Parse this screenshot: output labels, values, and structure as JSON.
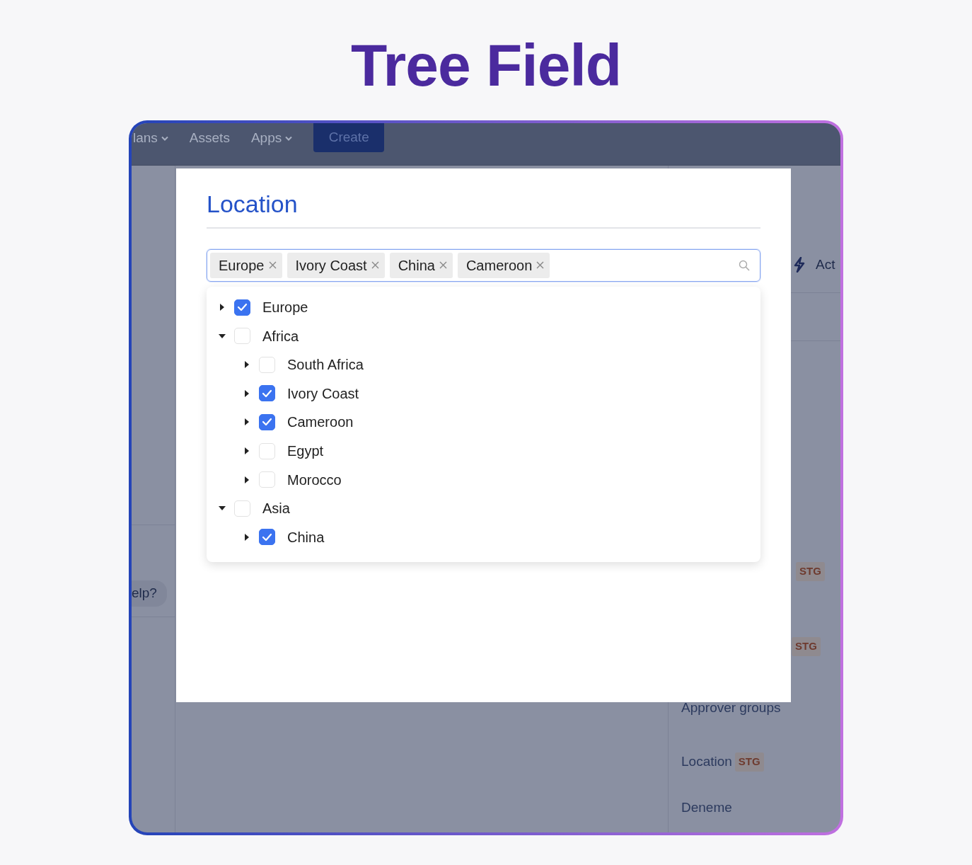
{
  "title": "Tree Field",
  "nav": {
    "items": [
      {
        "label": "lans",
        "dropdown": true
      },
      {
        "label": "Assets",
        "dropdown": false
      },
      {
        "label": "Apps",
        "dropdown": true
      }
    ],
    "create_button": "Create"
  },
  "sidebar": {
    "help": "elp?"
  },
  "right_panel": {
    "action": "Act",
    "badges": [
      "STG",
      "STG"
    ],
    "fields": [
      {
        "label": "Approver groups"
      },
      {
        "label": "Location",
        "badge": "STG"
      },
      {
        "label": "Deneme"
      }
    ]
  },
  "modal": {
    "title": "Location",
    "tags": [
      {
        "label": "Europe"
      },
      {
        "label": "Ivory Coast"
      },
      {
        "label": "China"
      },
      {
        "label": "Cameroon"
      }
    ],
    "tree": [
      {
        "label": "Europe",
        "checked": true,
        "expanded": false
      },
      {
        "label": "Africa",
        "checked": false,
        "expanded": true,
        "children": [
          {
            "label": "South Africa",
            "checked": false,
            "expanded": false
          },
          {
            "label": "Ivory Coast",
            "checked": true,
            "expanded": false
          },
          {
            "label": "Cameroon",
            "checked": true,
            "expanded": false
          },
          {
            "label": "Egypt",
            "checked": false,
            "expanded": false
          },
          {
            "label": "Morocco",
            "checked": false,
            "expanded": false
          }
        ]
      },
      {
        "label": "Asia",
        "checked": false,
        "expanded": true,
        "children": [
          {
            "label": "China",
            "checked": true,
            "expanded": false
          }
        ]
      }
    ]
  }
}
